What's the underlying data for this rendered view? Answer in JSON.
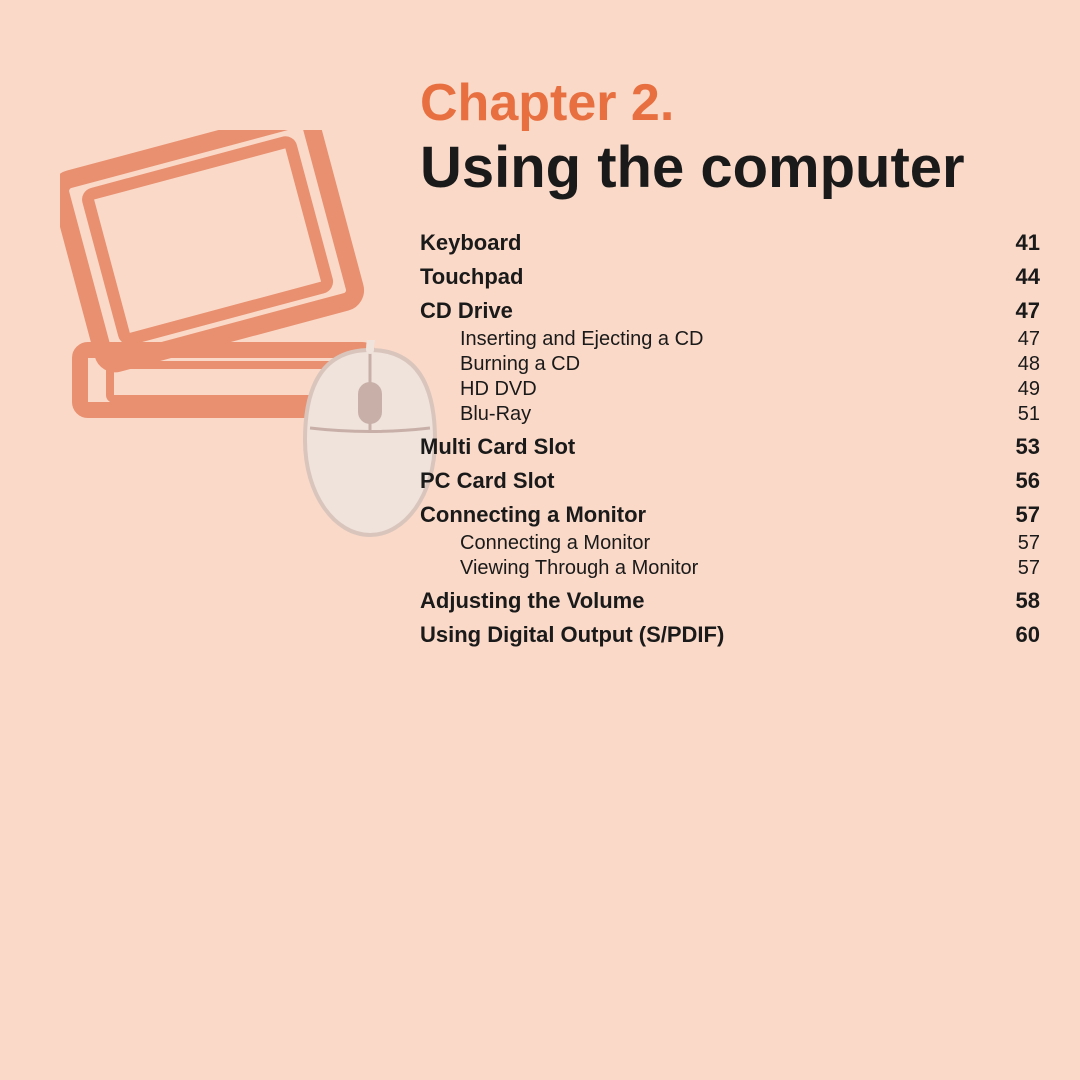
{
  "background_color": "#FAD9C8",
  "chapter": {
    "label": "Chapter 2.",
    "title": "Using the computer"
  },
  "toc": [
    {
      "label": "Keyboard",
      "page": "41",
      "type": "main"
    },
    {
      "label": "Touchpad",
      "page": "44",
      "type": "main"
    },
    {
      "label": "CD Drive",
      "page": "47",
      "type": "main"
    },
    {
      "label": "Inserting and Ejecting a CD",
      "page": "47",
      "type": "sub"
    },
    {
      "label": "Burning a CD",
      "page": "48",
      "type": "sub"
    },
    {
      "label": "HD DVD",
      "page": "49",
      "type": "sub"
    },
    {
      "label": "Blu-Ray",
      "page": "51",
      "type": "sub"
    },
    {
      "label": "Multi Card Slot",
      "page": "53",
      "type": "main"
    },
    {
      "label": "PC Card Slot",
      "page": "56",
      "type": "main"
    },
    {
      "label": "Connecting a Monitor",
      "page": "57",
      "type": "main"
    },
    {
      "label": "Connecting a Monitor",
      "page": "57",
      "type": "sub"
    },
    {
      "label": "Viewing Through a Monitor",
      "page": "57",
      "type": "sub"
    },
    {
      "label": "Adjusting the Volume",
      "page": "58",
      "type": "main"
    },
    {
      "label": "Using Digital Output (S/PDIF)",
      "page": "60",
      "type": "main"
    }
  ],
  "illustration": {
    "laptop_color": "#F0A882",
    "mouse_color": "#EEDFD8"
  }
}
